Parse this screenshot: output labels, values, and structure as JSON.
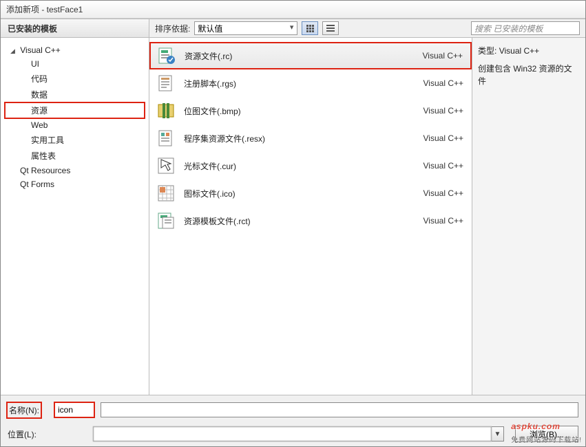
{
  "title": "添加新项 - testFace1",
  "leftHeader": "已安装的模板",
  "sortLabel": "排序依据:",
  "sortValue": "默认值",
  "searchPlaceholder": "搜索 已安装的模板",
  "tree": {
    "parent": "Visual C++",
    "children": [
      "UI",
      "代码",
      "数据",
      "资源",
      "Web",
      "实用工具",
      "属性表"
    ],
    "siblings": [
      "Qt Resources",
      "Qt Forms"
    ]
  },
  "templates": [
    {
      "name": "资源文件(.rc)",
      "cat": "Visual C++",
      "selected": true
    },
    {
      "name": "注册脚本(.rgs)",
      "cat": "Visual C++",
      "selected": false
    },
    {
      "name": "位图文件(.bmp)",
      "cat": "Visual C++",
      "selected": false
    },
    {
      "name": "程序集资源文件(.resx)",
      "cat": "Visual C++",
      "selected": false
    },
    {
      "name": "光标文件(.cur)",
      "cat": "Visual C++",
      "selected": false
    },
    {
      "name": "图标文件(.ico)",
      "cat": "Visual C++",
      "selected": false
    },
    {
      "name": "资源模板文件(.rct)",
      "cat": "Visual C++",
      "selected": false
    }
  ],
  "desc": {
    "type_label": "类型:",
    "type_value": "Visual C++",
    "text": "创建包含 Win32 资源的文件"
  },
  "form": {
    "name_label": "名称(N):",
    "name_value": "icon",
    "loc_label": "位置(L):",
    "loc_value": "",
    "browse": "浏览(B)..."
  },
  "watermark": {
    "brand": "aspku.com",
    "sub": "免费网站源码下载站!"
  }
}
